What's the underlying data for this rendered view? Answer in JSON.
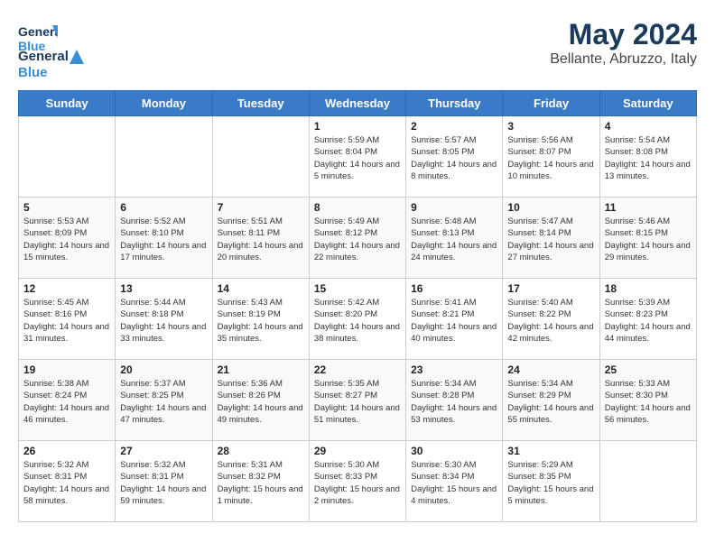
{
  "header": {
    "logo_general": "General",
    "logo_blue": "Blue",
    "title": "May 2024",
    "subtitle": "Bellante, Abruzzo, Italy"
  },
  "weekdays": [
    "Sunday",
    "Monday",
    "Tuesday",
    "Wednesday",
    "Thursday",
    "Friday",
    "Saturday"
  ],
  "days": {
    "d1": {
      "num": "1",
      "sunrise": "5:59 AM",
      "sunset": "8:04 PM",
      "daylight": "14 hours and 5 minutes."
    },
    "d2": {
      "num": "2",
      "sunrise": "5:57 AM",
      "sunset": "8:05 PM",
      "daylight": "14 hours and 8 minutes."
    },
    "d3": {
      "num": "3",
      "sunrise": "5:56 AM",
      "sunset": "8:07 PM",
      "daylight": "14 hours and 10 minutes."
    },
    "d4": {
      "num": "4",
      "sunrise": "5:54 AM",
      "sunset": "8:08 PM",
      "daylight": "14 hours and 13 minutes."
    },
    "d5": {
      "num": "5",
      "sunrise": "5:53 AM",
      "sunset": "8:09 PM",
      "daylight": "14 hours and 15 minutes."
    },
    "d6": {
      "num": "6",
      "sunrise": "5:52 AM",
      "sunset": "8:10 PM",
      "daylight": "14 hours and 17 minutes."
    },
    "d7": {
      "num": "7",
      "sunrise": "5:51 AM",
      "sunset": "8:11 PM",
      "daylight": "14 hours and 20 minutes."
    },
    "d8": {
      "num": "8",
      "sunrise": "5:49 AM",
      "sunset": "8:12 PM",
      "daylight": "14 hours and 22 minutes."
    },
    "d9": {
      "num": "9",
      "sunrise": "5:48 AM",
      "sunset": "8:13 PM",
      "daylight": "14 hours and 24 minutes."
    },
    "d10": {
      "num": "10",
      "sunrise": "5:47 AM",
      "sunset": "8:14 PM",
      "daylight": "14 hours and 27 minutes."
    },
    "d11": {
      "num": "11",
      "sunrise": "5:46 AM",
      "sunset": "8:15 PM",
      "daylight": "14 hours and 29 minutes."
    },
    "d12": {
      "num": "12",
      "sunrise": "5:45 AM",
      "sunset": "8:16 PM",
      "daylight": "14 hours and 31 minutes."
    },
    "d13": {
      "num": "13",
      "sunrise": "5:44 AM",
      "sunset": "8:18 PM",
      "daylight": "14 hours and 33 minutes."
    },
    "d14": {
      "num": "14",
      "sunrise": "5:43 AM",
      "sunset": "8:19 PM",
      "daylight": "14 hours and 35 minutes."
    },
    "d15": {
      "num": "15",
      "sunrise": "5:42 AM",
      "sunset": "8:20 PM",
      "daylight": "14 hours and 38 minutes."
    },
    "d16": {
      "num": "16",
      "sunrise": "5:41 AM",
      "sunset": "8:21 PM",
      "daylight": "14 hours and 40 minutes."
    },
    "d17": {
      "num": "17",
      "sunrise": "5:40 AM",
      "sunset": "8:22 PM",
      "daylight": "14 hours and 42 minutes."
    },
    "d18": {
      "num": "18",
      "sunrise": "5:39 AM",
      "sunset": "8:23 PM",
      "daylight": "14 hours and 44 minutes."
    },
    "d19": {
      "num": "19",
      "sunrise": "5:38 AM",
      "sunset": "8:24 PM",
      "daylight": "14 hours and 46 minutes."
    },
    "d20": {
      "num": "20",
      "sunrise": "5:37 AM",
      "sunset": "8:25 PM",
      "daylight": "14 hours and 47 minutes."
    },
    "d21": {
      "num": "21",
      "sunrise": "5:36 AM",
      "sunset": "8:26 PM",
      "daylight": "14 hours and 49 minutes."
    },
    "d22": {
      "num": "22",
      "sunrise": "5:35 AM",
      "sunset": "8:27 PM",
      "daylight": "14 hours and 51 minutes."
    },
    "d23": {
      "num": "23",
      "sunrise": "5:34 AM",
      "sunset": "8:28 PM",
      "daylight": "14 hours and 53 minutes."
    },
    "d24": {
      "num": "24",
      "sunrise": "5:34 AM",
      "sunset": "8:29 PM",
      "daylight": "14 hours and 55 minutes."
    },
    "d25": {
      "num": "25",
      "sunrise": "5:33 AM",
      "sunset": "8:30 PM",
      "daylight": "14 hours and 56 minutes."
    },
    "d26": {
      "num": "26",
      "sunrise": "5:32 AM",
      "sunset": "8:31 PM",
      "daylight": "14 hours and 58 minutes."
    },
    "d27": {
      "num": "27",
      "sunrise": "5:32 AM",
      "sunset": "8:31 PM",
      "daylight": "14 hours and 59 minutes."
    },
    "d28": {
      "num": "28",
      "sunrise": "5:31 AM",
      "sunset": "8:32 PM",
      "daylight": "15 hours and 1 minute."
    },
    "d29": {
      "num": "29",
      "sunrise": "5:30 AM",
      "sunset": "8:33 PM",
      "daylight": "15 hours and 2 minutes."
    },
    "d30": {
      "num": "30",
      "sunrise": "5:30 AM",
      "sunset": "8:34 PM",
      "daylight": "15 hours and 4 minutes."
    },
    "d31": {
      "num": "31",
      "sunrise": "5:29 AM",
      "sunset": "8:35 PM",
      "daylight": "15 hours and 5 minutes."
    }
  }
}
